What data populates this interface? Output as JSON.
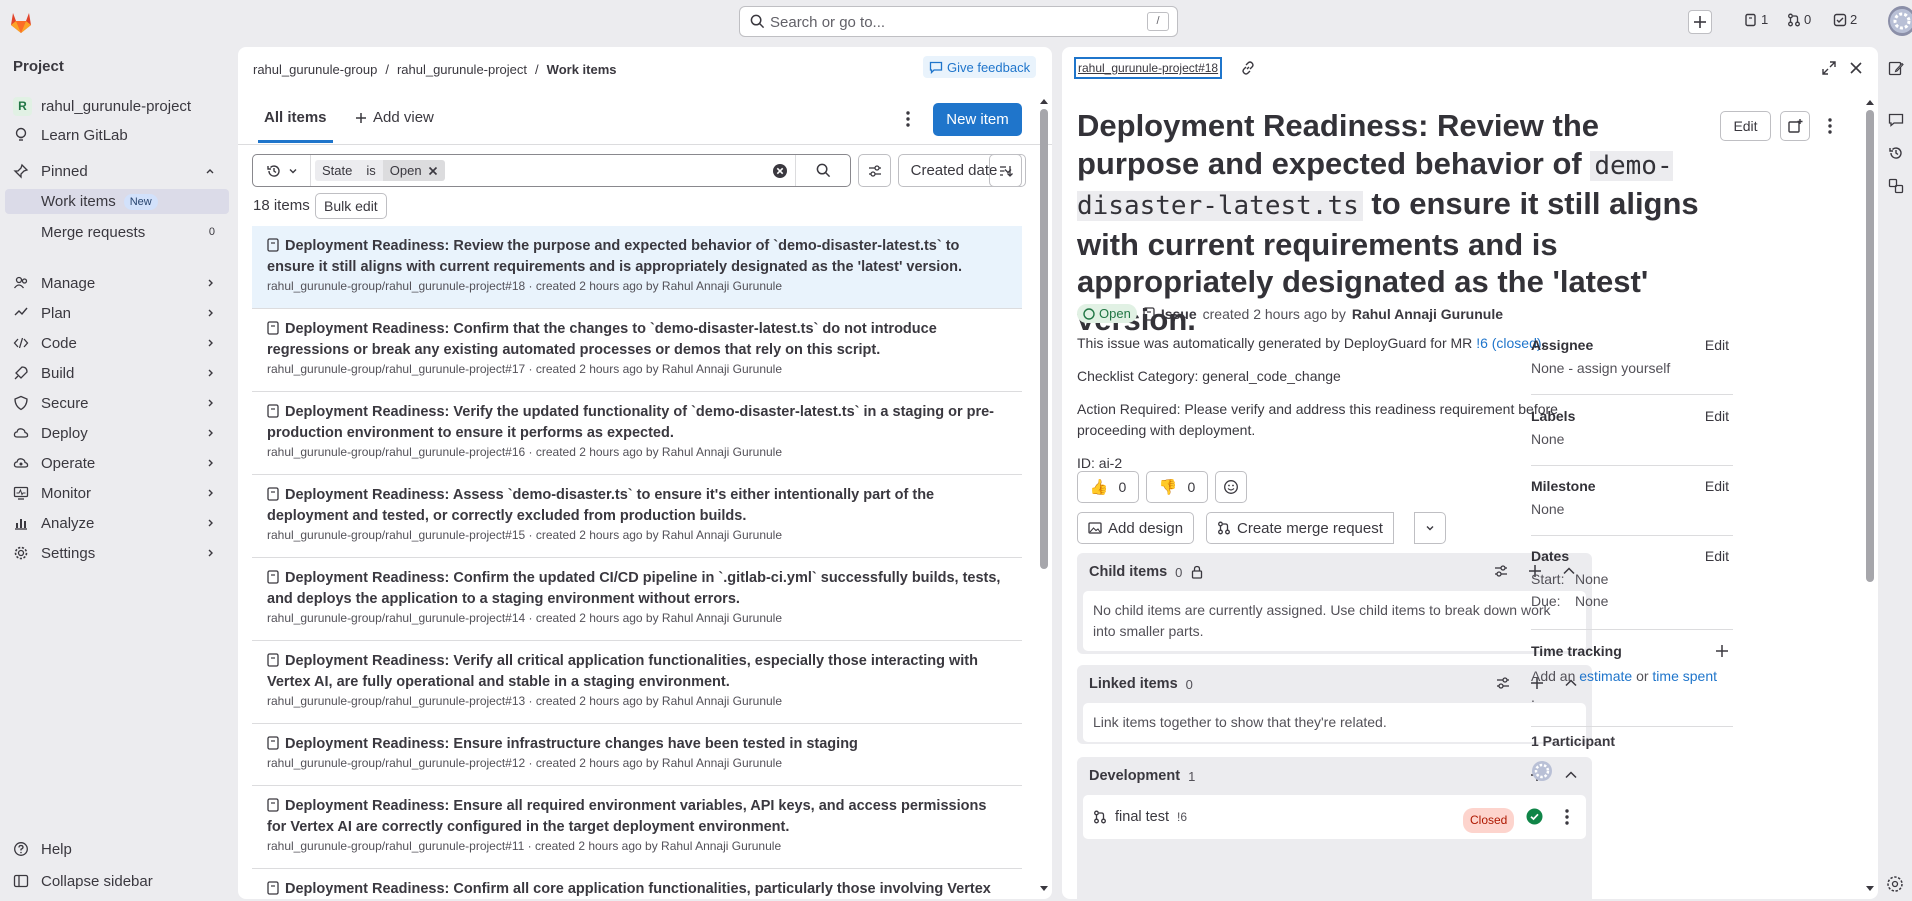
{
  "topbar": {
    "search_placeholder": "Search or go to...",
    "search_shortcut": "/",
    "issues_count": "1",
    "mr_count": "0",
    "todos_count": "2"
  },
  "sidebar": {
    "heading": "Project",
    "project_avatar_letter": "R",
    "project_name": "rahul_gurunule-project",
    "learn": "Learn GitLab",
    "pinned": "Pinned",
    "work_items": "Work items",
    "new_badge": "New",
    "merge_requests": "Merge requests",
    "mr_count": "0",
    "manage": "Manage",
    "plan": "Plan",
    "code": "Code",
    "build": "Build",
    "secure": "Secure",
    "deploy": "Deploy",
    "operate": "Operate",
    "monitor": "Monitor",
    "analyze": "Analyze",
    "settings": "Settings",
    "help": "Help",
    "collapse": "Collapse sidebar"
  },
  "list": {
    "breadcrumb": [
      "rahul_gurunule-group",
      "rahul_gurunule-project",
      "Work items"
    ],
    "give_feedback": "Give feedback",
    "tab_all": "All items",
    "tab_add": "Add view",
    "new_item": "New item",
    "filter": {
      "field": "State",
      "op": "is",
      "value": "Open"
    },
    "sort": "Created date",
    "count": "18 items",
    "bulk_edit": "Bulk edit",
    "items": [
      {
        "title": "Deployment Readiness: Review the purpose and expected behavior of `demo-disaster-latest.ts` to ensure it still aligns with current requirements and is appropriately designated as the 'latest' version.",
        "meta": "rahul_gurunule-group/rahul_gurunule-project#18 · created 2 hours ago by Rahul Annaji Gurunule"
      },
      {
        "title": "Deployment Readiness: Confirm that the changes to `demo-disaster-latest.ts` do not introduce regressions or break any existing automated processes or demos that rely on this script.",
        "meta": "rahul_gurunule-group/rahul_gurunule-project#17 · created 2 hours ago by Rahul Annaji Gurunule"
      },
      {
        "title": "Deployment Readiness: Verify the updated functionality of `demo-disaster-latest.ts` in a staging or pre-production environment to ensure it performs as expected.",
        "meta": "rahul_gurunule-group/rahul_gurunule-project#16 · created 2 hours ago by Rahul Annaji Gurunule"
      },
      {
        "title": "Deployment Readiness: Assess `demo-disaster.ts` to ensure it's either intentionally part of the deployment and tested, or correctly excluded from production builds.",
        "meta": "rahul_gurunule-group/rahul_gurunule-project#15 · created 2 hours ago by Rahul Annaji Gurunule"
      },
      {
        "title": "Deployment Readiness: Confirm the updated CI/CD pipeline in `.gitlab-ci.yml` successfully builds, tests, and deploys the application to a staging environment without errors.",
        "meta": "rahul_gurunule-group/rahul_gurunule-project#14 · created 2 hours ago by Rahul Annaji Gurunule"
      },
      {
        "title": "Deployment Readiness: Verify all critical application functionalities, especially those interacting with Vertex AI, are fully operational and stable in a staging environment.",
        "meta": "rahul_gurunule-group/rahul_gurunule-project#13 · created 2 hours ago by Rahul Annaji Gurunule"
      },
      {
        "title": "Deployment Readiness: Ensure infrastructure changes have been tested in staging",
        "meta": "rahul_gurunule-group/rahul_gurunule-project#12 · created 2 hours ago by Rahul Annaji Gurunule"
      },
      {
        "title": "Deployment Readiness: Ensure all required environment variables, API keys, and access permissions for Vertex AI are correctly configured in the target deployment environment.",
        "meta": "rahul_gurunule-group/rahul_gurunule-project#11 · created 2 hours ago by Rahul Annaji Gurunule"
      },
      {
        "title": "Deployment Readiness: Confirm all core application functionalities, particularly those involving Vertex",
        "meta": ""
      }
    ]
  },
  "detail": {
    "ref": "rahul_gurunule-project#18",
    "title_a": "Deployment Readiness: Review the purpose and expected behavior of ",
    "title_code": "demo-disaster-latest.ts",
    "title_b": " to ensure it still aligns with current requirements and is appropriately designated as the 'latest' version.",
    "edit": "Edit",
    "status": "Open",
    "type": "Issue",
    "created": "created 2 hours ago by",
    "author": "Rahul Annaji Gurunule",
    "desc1_a": "This issue was automatically generated by DeployGuard for MR ",
    "desc1_link": "!6 (closed)",
    "desc1_b": ".",
    "cat_label": "Checklist Category:",
    "cat_value": " general_code_change",
    "action_label": "Action Required:",
    "action_value": " Please verify and address this readiness requirement before proceeding with deployment.",
    "id_line": "ID: ai-2",
    "thumbs_up": "0",
    "thumbs_down": "0",
    "add_design": "Add design",
    "create_mr": "Create merge request",
    "child": {
      "title": "Child items",
      "count": "0",
      "body": "No child items are currently assigned. Use child items to break down work into smaller parts."
    },
    "linked": {
      "title": "Linked items",
      "count": "0",
      "body": "Link items together to show that they're related."
    },
    "dev": {
      "title": "Development",
      "count": "1",
      "item": "final test",
      "item_ref": "!6",
      "item_status": "Closed"
    },
    "side": {
      "assignee_h": "Assignee",
      "assignee_v": "None - assign yourself",
      "labels_h": "Labels",
      "labels_v": "None",
      "milestone_h": "Milestone",
      "milestone_v": "None",
      "dates_h": "Dates",
      "start": "Start:",
      "start_v": "None",
      "due": "Due:",
      "due_v": "None",
      "time_h": "Time tracking",
      "time_a": "Add an ",
      "time_est": "estimate",
      "time_or": " or ",
      "time_spent": "time spent",
      "time_dot": ".",
      "participants": "1 Participant",
      "edit": "Edit"
    }
  },
  "colors": {
    "accent": "#1f75cb",
    "bg": "#ececef",
    "open": "#217645",
    "closed": "#ae1800"
  }
}
